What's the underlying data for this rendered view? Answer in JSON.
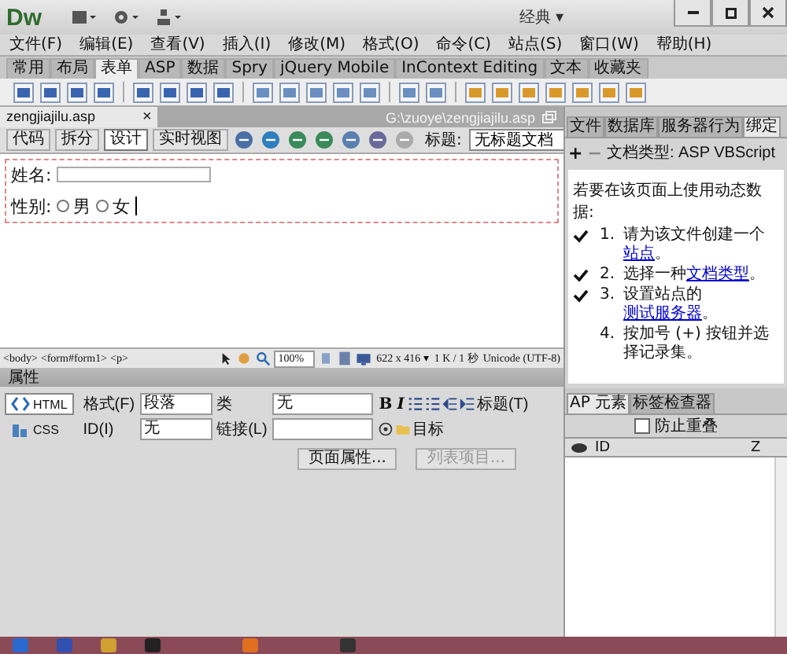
{
  "app": {
    "logo": "Dw",
    "workspace": "经典 ▾"
  },
  "menu": [
    "文件(F)",
    "编辑(E)",
    "查看(V)",
    "插入(I)",
    "修改(M)",
    "格式(O)",
    "命令(C)",
    "站点(S)",
    "窗口(W)",
    "帮助(H)"
  ],
  "insert_tabs": [
    {
      "label": "常用",
      "selected": false
    },
    {
      "label": "布局",
      "selected": false
    },
    {
      "label": "表单",
      "selected": true
    },
    {
      "label": "ASP",
      "selected": false
    },
    {
      "label": "数据",
      "selected": false
    },
    {
      "label": "Spry",
      "selected": false
    },
    {
      "label": "jQuery Mobile",
      "selected": false
    },
    {
      "label": "InContext Editing",
      "selected": false
    },
    {
      "label": "文本",
      "selected": false
    },
    {
      "label": "收藏夹",
      "selected": false
    }
  ],
  "document": {
    "tab": "zengjiajilu.asp",
    "close": "×",
    "path": "G:\\zuoye\\zengjiajilu.asp",
    "views": [
      {
        "label": "代码",
        "selected": false
      },
      {
        "label": "拆分",
        "selected": false
      },
      {
        "label": "设计",
        "selected": true
      },
      {
        "label": "实时视图",
        "selected": false
      }
    ],
    "title_label": "标题:",
    "title_value": "无标题文档"
  },
  "form": {
    "name_label": "姓名:",
    "gender_label": "性别:",
    "options": [
      {
        "label": "男",
        "selected": false
      },
      {
        "label": "女",
        "selected": false
      }
    ]
  },
  "status": {
    "tags": [
      "<body>",
      "<form#form1>",
      "<p>"
    ],
    "zoom": "100%",
    "size": "622 x 416 ▾",
    "speed": "1 K / 1 秒",
    "encoding": "Unicode (UTF-8)"
  },
  "properties": {
    "title": "属性",
    "modes": [
      {
        "label": "HTML",
        "selected": true
      },
      {
        "label": "CSS",
        "selected": false
      }
    ],
    "format_label": "格式(F)",
    "format_value": "段落",
    "id_label": "ID(I)",
    "id_value": "无",
    "class_label": "类",
    "class_value": "无",
    "link_label": "链接(L)",
    "bold": "B",
    "italic": "I",
    "heading_label": "标题(T)",
    "target_label": "目标",
    "page_props": "页面属性...",
    "list_item": {
      "label": "列表项目...",
      "disabled": true
    }
  },
  "right_panel": {
    "tabs": [
      {
        "label": "文件",
        "selected": false
      },
      {
        "label": "数据库",
        "selected": false
      },
      {
        "label": "服务器行为",
        "selected": false
      },
      {
        "label": "绑定",
        "selected": true
      }
    ],
    "add": "+",
    "remove": "−",
    "doc_type": "文档类型: ASP VBScript",
    "intro": "若要在该页面上使用动态数据:",
    "steps": [
      {
        "number": "1.",
        "before": "请为该文件创建一个",
        "link": "站点",
        "after": "。",
        "checked": true
      },
      {
        "number": "2.",
        "before": "选择一种",
        "link": "文档类型",
        "after": "。",
        "checked": true
      },
      {
        "number": "3.",
        "before": "设置站点的",
        "link": "测试服务器",
        "after": "。",
        "checked": true
      },
      {
        "number": "4.",
        "before": "按加号 (+) 按钮并选择记录集。",
        "checked": false
      }
    ]
  },
  "ap_panel": {
    "tabs": [
      {
        "label": "AP 元素",
        "selected": true
      },
      {
        "label": "标签检查器",
        "selected": false
      }
    ],
    "prevent_overlap": {
      "label": "防止重叠",
      "checked": false
    },
    "columns": [
      "ID",
      "Z"
    ]
  }
}
